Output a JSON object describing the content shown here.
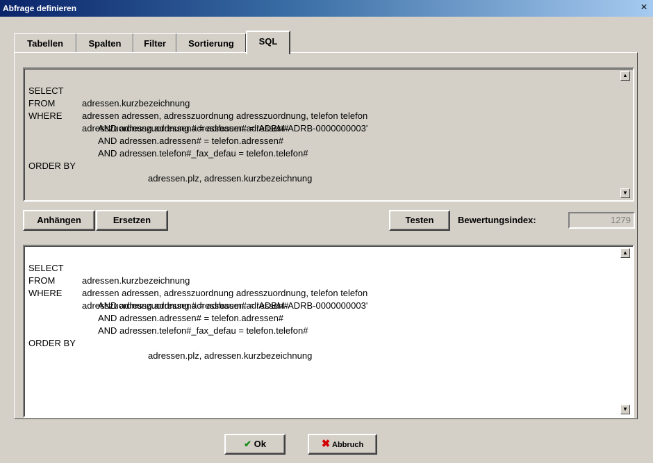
{
  "window": {
    "title": "Abfrage definieren",
    "close_glyph": "×"
  },
  "tabs": [
    {
      "label": "Tabellen"
    },
    {
      "label": "Spalten"
    },
    {
      "label": "Filter"
    },
    {
      "label": "Sortierung"
    },
    {
      "label": "SQL",
      "active": true
    }
  ],
  "sql_top": {
    "lines": [
      {
        "keyword": "SELECT",
        "text": "adressen.kurzbezeichnung"
      },
      {
        "keyword": "FROM",
        "text": "adressen adressen, adresszuordnung adresszuordnung, telefon telefon"
      },
      {
        "keyword": "WHERE",
        "text": "adresszuordnung.adressen# = adressen.adressen#"
      },
      {
        "keyword": "",
        "text": "AND adresszuordnung.adressbaum# = 'ADBM-ADRB-0000000003'"
      },
      {
        "keyword": "",
        "text": "AND adressen.adressen# = telefon.adressen#"
      },
      {
        "keyword": "",
        "text": "AND adressen.telefon#_fax_defau = telefon.telefon#"
      },
      {
        "keyword": "ORDER BY",
        "text": "adressen.plz, adressen.kurzbezeichnung"
      }
    ]
  },
  "sql_bottom": {
    "lines": [
      {
        "keyword": "SELECT",
        "text": "adressen.kurzbezeichnung"
      },
      {
        "keyword": "FROM",
        "text": "adressen adressen, adresszuordnung adresszuordnung, telefon telefon"
      },
      {
        "keyword": "WHERE",
        "text": "adresszuordnung.adressen# = adressen.adressen#"
      },
      {
        "keyword": "",
        "text": "AND adresszuordnung.adressbaum# = 'ADBM-ADRB-0000000003'"
      },
      {
        "keyword": "",
        "text": "AND adressen.adressen# = telefon.adressen#"
      },
      {
        "keyword": "",
        "text": "AND adressen.telefon#_fax_defau = telefon.telefon#"
      },
      {
        "keyword": "ORDER BY",
        "text": "adressen.plz, adressen.kurzbezeichnung"
      }
    ]
  },
  "actions": {
    "append_label": "Anhängen",
    "replace_label": "Ersetzen",
    "test_label": "Testen",
    "rating_label": "Bewertungsindex:",
    "rating_value": "1279"
  },
  "footer": {
    "ok_label": "Ok",
    "cancel_label": "Abbruch",
    "ok_icon": "checkmark-icon",
    "cancel_icon": "x-icon"
  },
  "colors": {
    "dialog_bg": "#d4d0c8",
    "titlebar_start": "#0a246a",
    "titlebar_end": "#a6caf0",
    "ok_icon": "#1a8c1a",
    "cancel_icon": "#d40000"
  }
}
